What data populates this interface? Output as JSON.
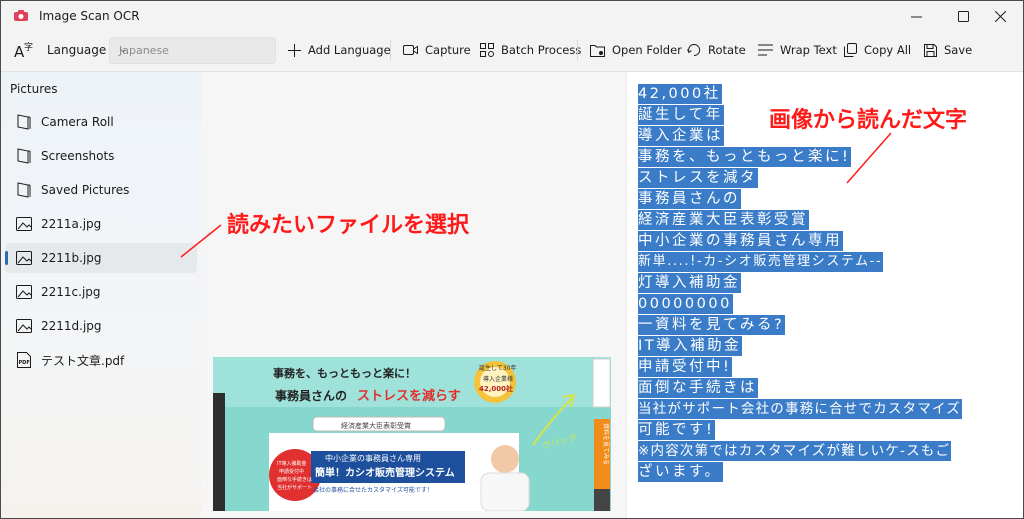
{
  "app": {
    "title": "Image Scan OCR"
  },
  "toolbar": {
    "language_label": "Language",
    "language_value": "Japanese",
    "add_language": "Add Language",
    "capture": "Capture",
    "batch_process": "Batch Process",
    "open_folder": "Open Folder",
    "rotate": "Rotate",
    "wrap_text": "Wrap Text",
    "copy_all": "Copy All",
    "save": "Save"
  },
  "sidebar": {
    "heading": "Pictures",
    "items": [
      {
        "label": "Camera Roll",
        "icon": "folder-icon"
      },
      {
        "label": "Screenshots",
        "icon": "folder-icon"
      },
      {
        "label": "Saved Pictures",
        "icon": "folder-icon"
      },
      {
        "label": "2211a.jpg",
        "icon": "image-icon"
      },
      {
        "label": "2211b.jpg",
        "icon": "image-icon",
        "selected": true
      },
      {
        "label": "2211c.jpg",
        "icon": "image-icon"
      },
      {
        "label": "2211d.jpg",
        "icon": "image-icon"
      },
      {
        "label": "テスト文章.pdf",
        "icon": "pdf-icon"
      }
    ]
  },
  "preview": {
    "headline1": "事務を、もっともっと楽に！",
    "headline2a": "事務員さんの",
    "headline2b": "ストレスを減らす",
    "badge1": "誕生して30年",
    "badge2": "導入企業様",
    "badge3": "42,000社",
    "award": "経済産業大臣表彰受賞",
    "product_sub": "中小企業の事務員さん専用",
    "product_name": "簡単！カシオ販売管理システム",
    "product_desc": "会社の事務に合せたカスタマイズ可能です！",
    "circle1": "IT導入補助金",
    "circle2": "申請受付中",
    "circle3": "面倒な手続きは",
    "circle4": "当社がサポート",
    "side_tab": "資料を見てみる",
    "click": "クリック"
  },
  "ocr": {
    "lines": [
      "42,000社",
      "誕生して年",
      "導入企業は",
      "事務を、もっともっと楽に!",
      "ストレスを減タ",
      "事務員さんの",
      "経済産業大臣表彰受賞",
      "中小企業の事務員さん専用",
      "新単....!-カ-シオ販売管理システム--",
      "灯導入補助金",
      "00000000",
      "一資料を見てみる?",
      "IT導入補助金",
      "申請受付中!",
      "面倒な手続きは",
      "当社がサポート会社の事務に合せでカスタマイズ",
      "可能です!",
      "※内容次第ではカスタマイズが難しいケ-スもご",
      "ざいます。"
    ]
  },
  "annotations": {
    "select_file": "読みたいファイルを選択",
    "read_text": "画像から読んだ文字"
  },
  "colors": {
    "selection": "#3a7cc8",
    "annotation": "#ff1a1a",
    "accent": "#2b6cb0"
  }
}
